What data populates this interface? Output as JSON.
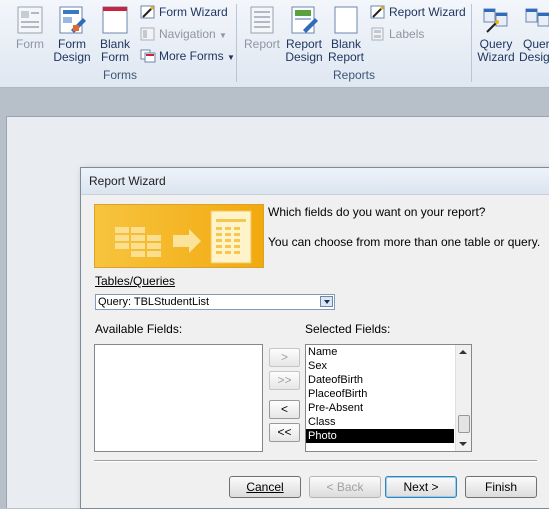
{
  "ribbon": {
    "forms_group": {
      "label": "Forms",
      "form": "Form",
      "form_design": [
        "Form",
        "Design"
      ],
      "blank_form": [
        "Blank",
        "Form"
      ],
      "form_wizard": "Form Wizard",
      "navigation": "Navigation",
      "more_forms": "More Forms"
    },
    "reports_group": {
      "label": "Reports",
      "report": "Report",
      "report_design": [
        "Report",
        "Design"
      ],
      "blank_report": [
        "Blank",
        "Report"
      ],
      "report_wizard": "Report Wizard",
      "labels": "Labels"
    },
    "other_group": {
      "query_wizard": [
        "Query",
        "Wizard"
      ],
      "query_design": [
        "Quer",
        "Desig"
      ]
    }
  },
  "dialog": {
    "title": "Report Wizard",
    "question": "Which fields do you want on your report?",
    "hint": "You can choose from more than one table or query.",
    "tables_label": "Tables/Queries",
    "tables_value": "Query: TBLStudentList",
    "available_label": "Available Fields:",
    "selected_label": "Selected Fields:",
    "selected_fields": [
      "Name",
      "Sex",
      "DateofBirth",
      "PlaceofBirth",
      "Pre-Absent",
      "Class",
      "Photo"
    ],
    "buttons": {
      "add_one": ">",
      "add_all": ">>",
      "remove_one": "<",
      "remove_all": "<<",
      "cancel": "Cancel",
      "back": "< Back",
      "next": "Next >",
      "finish": "Finish"
    }
  }
}
